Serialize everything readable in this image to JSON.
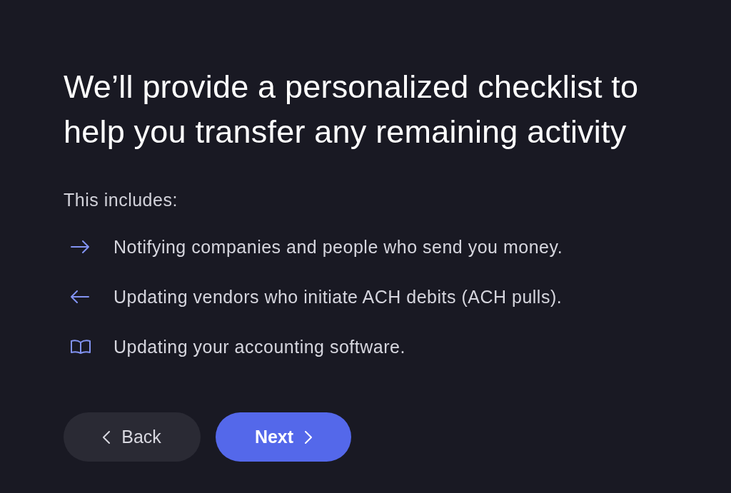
{
  "heading": "We’ll provide a personalized checklist to help you transfer any remaining activity",
  "intro": "This includes:",
  "items": [
    {
      "kind": "arrow-right",
      "text": "Notifying companies and people who send you money."
    },
    {
      "kind": "arrow-left",
      "text": "Updating vendors who initiate ACH debits (ACH pulls)."
    },
    {
      "kind": "book",
      "text": "Updating your accounting software."
    }
  ],
  "buttons": [
    {
      "kind": "back",
      "label": "Back"
    },
    {
      "kind": "next",
      "label": "Next"
    }
  ]
}
